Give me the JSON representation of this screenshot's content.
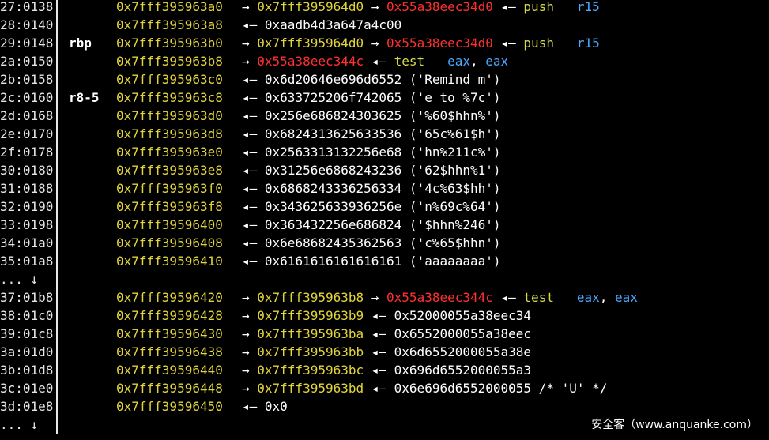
{
  "colors": {
    "background": "#000000",
    "address": "#e2d43c",
    "code_ptr": "#ff3030",
    "mnemonic": "#d5d94a",
    "register": "#4aa8ff"
  },
  "rows": [
    {
      "off": "27:0138",
      "reg": "",
      "addr": "0x7fff395963a0",
      "rest": [
        {
          "t": "→ ",
          "c": "w"
        },
        {
          "t": "0x7fff395964d0",
          "c": "y"
        },
        {
          "t": " → ",
          "c": "w"
        },
        {
          "t": "0x55a38eec34d0",
          "c": "r"
        },
        {
          "t": " ◂— ",
          "c": "w"
        },
        {
          "t": "push",
          "c": "g"
        },
        {
          "t": "   ",
          "c": "w"
        },
        {
          "t": "r15",
          "c": "b"
        }
      ]
    },
    {
      "off": "28:0140",
      "reg": "",
      "addr": "0x7fff395963a8",
      "rest": [
        {
          "t": "◂— ",
          "c": "w"
        },
        {
          "t": "0xaadb4d3a647a4c00",
          "c": "w"
        }
      ]
    },
    {
      "off": "29:0148",
      "reg": "rbp",
      "addr": "0x7fff395963b0",
      "rest": [
        {
          "t": "→ ",
          "c": "w"
        },
        {
          "t": "0x7fff395964d0",
          "c": "y"
        },
        {
          "t": " → ",
          "c": "w"
        },
        {
          "t": "0x55a38eec34d0",
          "c": "r"
        },
        {
          "t": " ◂— ",
          "c": "w"
        },
        {
          "t": "push",
          "c": "g"
        },
        {
          "t": "   ",
          "c": "w"
        },
        {
          "t": "r15",
          "c": "b"
        }
      ]
    },
    {
      "off": "2a:0150",
      "reg": "",
      "addr": "0x7fff395963b8",
      "rest": [
        {
          "t": "→ ",
          "c": "w"
        },
        {
          "t": "0x55a38eec344c",
          "c": "r"
        },
        {
          "t": " ◂— ",
          "c": "w"
        },
        {
          "t": "test",
          "c": "g"
        },
        {
          "t": "   ",
          "c": "w"
        },
        {
          "t": "eax",
          "c": "b"
        },
        {
          "t": ", ",
          "c": "w"
        },
        {
          "t": "eax",
          "c": "b"
        }
      ]
    },
    {
      "off": "2b:0158",
      "reg": "",
      "addr": "0x7fff395963c0",
      "rest": [
        {
          "t": "◂— ",
          "c": "w"
        },
        {
          "t": "0x6d20646e696d6552 ('Remind m')",
          "c": "w"
        }
      ]
    },
    {
      "off": "2c:0160",
      "reg": "r8-5",
      "addr": "0x7fff395963c8",
      "rest": [
        {
          "t": "◂— ",
          "c": "w"
        },
        {
          "t": "0x633725206f742065 ('e to %7c')",
          "c": "w"
        }
      ]
    },
    {
      "off": "2d:0168",
      "reg": "",
      "addr": "0x7fff395963d0",
      "rest": [
        {
          "t": "◂— ",
          "c": "w"
        },
        {
          "t": "0x256e686824303625 ('%60$hhn%')",
          "c": "w"
        }
      ]
    },
    {
      "off": "2e:0170",
      "reg": "",
      "addr": "0x7fff395963d8",
      "rest": [
        {
          "t": "◂— ",
          "c": "w"
        },
        {
          "t": "0x6824313625633536 ('65c%61$h')",
          "c": "w"
        }
      ]
    },
    {
      "off": "2f:0178",
      "reg": "",
      "addr": "0x7fff395963e0",
      "rest": [
        {
          "t": "◂— ",
          "c": "w"
        },
        {
          "t": "0x2563313132256e68 ('hn%211c%')",
          "c": "w"
        }
      ]
    },
    {
      "off": "30:0180",
      "reg": "",
      "addr": "0x7fff395963e8",
      "rest": [
        {
          "t": "◂— ",
          "c": "w"
        },
        {
          "t": "0x31256e6868243236 ('62$hhn%1')",
          "c": "w"
        }
      ]
    },
    {
      "off": "31:0188",
      "reg": "",
      "addr": "0x7fff395963f0",
      "rest": [
        {
          "t": "◂— ",
          "c": "w"
        },
        {
          "t": "0x6868243336256334 ('4c%63$hh')",
          "c": "w"
        }
      ]
    },
    {
      "off": "32:0190",
      "reg": "",
      "addr": "0x7fff395963f8",
      "rest": [
        {
          "t": "◂— ",
          "c": "w"
        },
        {
          "t": "0x343625633936256e ('n%69c%64')",
          "c": "w"
        }
      ]
    },
    {
      "off": "33:0198",
      "reg": "",
      "addr": "0x7fff39596400",
      "rest": [
        {
          "t": "◂— ",
          "c": "w"
        },
        {
          "t": "0x363432256e686824 ('$hhn%246')",
          "c": "w"
        }
      ]
    },
    {
      "off": "34:01a0",
      "reg": "",
      "addr": "0x7fff39596408",
      "rest": [
        {
          "t": "◂— ",
          "c": "w"
        },
        {
          "t": "0x6e68682435362563 ('c%65$hhn')",
          "c": "w"
        }
      ]
    },
    {
      "off": "35:01a8",
      "reg": "",
      "addr": "0x7fff39596410",
      "rest": [
        {
          "t": "◂— ",
          "c": "w"
        },
        {
          "t": "0x6161616161616161 ('aaaaaaaa')",
          "c": "w"
        }
      ]
    },
    {
      "off": "... ↓",
      "reg": "",
      "addr": "",
      "rest": []
    },
    {
      "off": "37:01b8",
      "reg": "",
      "addr": "0x7fff39596420",
      "rest": [
        {
          "t": "→ ",
          "c": "w"
        },
        {
          "t": "0x7fff395963b8",
          "c": "y"
        },
        {
          "t": " → ",
          "c": "w"
        },
        {
          "t": "0x55a38eec344c",
          "c": "r"
        },
        {
          "t": " ◂— ",
          "c": "w"
        },
        {
          "t": "test",
          "c": "g"
        },
        {
          "t": "   ",
          "c": "w"
        },
        {
          "t": "eax",
          "c": "b"
        },
        {
          "t": ", ",
          "c": "w"
        },
        {
          "t": "eax",
          "c": "b"
        }
      ]
    },
    {
      "off": "38:01c0",
      "reg": "",
      "addr": "0x7fff39596428",
      "rest": [
        {
          "t": "→ ",
          "c": "w"
        },
        {
          "t": "0x7fff395963b9",
          "c": "y"
        },
        {
          "t": " ◂— ",
          "c": "w"
        },
        {
          "t": "0x52000055a38eec34",
          "c": "w"
        }
      ]
    },
    {
      "off": "39:01c8",
      "reg": "",
      "addr": "0x7fff39596430",
      "rest": [
        {
          "t": "→ ",
          "c": "w"
        },
        {
          "t": "0x7fff395963ba",
          "c": "y"
        },
        {
          "t": " ◂— ",
          "c": "w"
        },
        {
          "t": "0x6552000055a38eec",
          "c": "w"
        }
      ]
    },
    {
      "off": "3a:01d0",
      "reg": "",
      "addr": "0x7fff39596438",
      "rest": [
        {
          "t": "→ ",
          "c": "w"
        },
        {
          "t": "0x7fff395963bb",
          "c": "y"
        },
        {
          "t": " ◂— ",
          "c": "w"
        },
        {
          "t": "0x6d6552000055a38e",
          "c": "w"
        }
      ]
    },
    {
      "off": "3b:01d8",
      "reg": "",
      "addr": "0x7fff39596440",
      "rest": [
        {
          "t": "→ ",
          "c": "w"
        },
        {
          "t": "0x7fff395963bc",
          "c": "y"
        },
        {
          "t": " ◂— ",
          "c": "w"
        },
        {
          "t": "0x696d6552000055a3",
          "c": "w"
        }
      ]
    },
    {
      "off": "3c:01e0",
      "reg": "",
      "addr": "0x7fff39596448",
      "rest": [
        {
          "t": "→ ",
          "c": "w"
        },
        {
          "t": "0x7fff395963bd",
          "c": "y"
        },
        {
          "t": " ◂— ",
          "c": "w"
        },
        {
          "t": "0x6e696d6552000055 /* 'U' */",
          "c": "w"
        }
      ]
    },
    {
      "off": "3d:01e8",
      "reg": "",
      "addr": "0x7fff39596450",
      "rest": [
        {
          "t": "◂— ",
          "c": "w"
        },
        {
          "t": "0x0",
          "c": "w"
        }
      ]
    },
    {
      "off": "... ↓",
      "reg": "",
      "addr": "",
      "rest": []
    }
  ],
  "watermark": "安全客（www.anquanke.com）"
}
